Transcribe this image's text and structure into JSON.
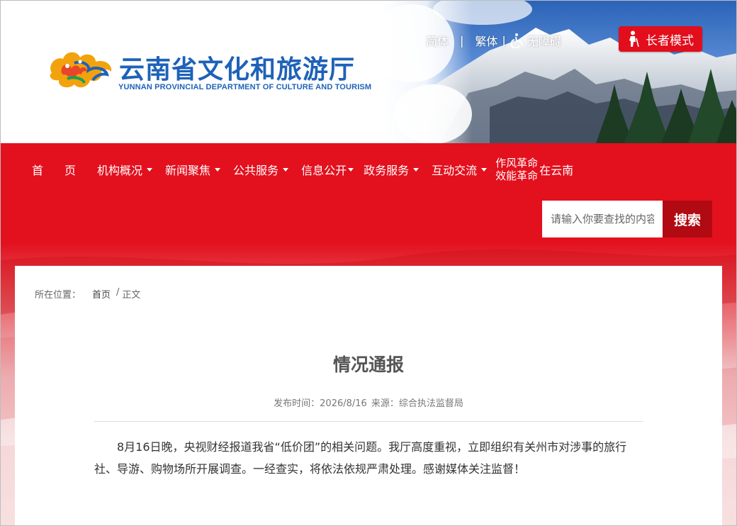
{
  "header": {
    "title": "云南省文化和旅游厅",
    "subtitle": "YUNNAN PROVINCIAL DEPARTMENT OF CULTURE AND TOURISM",
    "top_links": {
      "simplified": "简体",
      "separator": "|",
      "traditional": "繁体",
      "separator2": "|",
      "accessibility": "无障碍"
    },
    "elder_mode": "长者模式"
  },
  "nav": {
    "items": [
      {
        "label": "首页",
        "has_dropdown": false
      },
      {
        "label": "机构概况",
        "has_dropdown": true
      },
      {
        "label": "新闻聚焦",
        "has_dropdown": true
      },
      {
        "label": "公共服务",
        "has_dropdown": true
      },
      {
        "label": "信息公开",
        "has_dropdown": true
      },
      {
        "label": "政务服务",
        "has_dropdown": true
      },
      {
        "label": "互动交流",
        "has_dropdown": true
      }
    ],
    "special": {
      "line1": "作风革命",
      "line2": "效能革命",
      "suffix": "在云南"
    },
    "search": {
      "placeholder": "请输入你要查找的内容",
      "button": "搜索"
    }
  },
  "breadcrumb": {
    "label": "所在位置：",
    "home": "首页",
    "separator": "/",
    "current": "正文"
  },
  "article": {
    "title": "情况通报",
    "publish_label": "发布时间：",
    "publish_date": "2026/8/16",
    "source_label": "来源：",
    "source": "综合执法监督局",
    "body": "8月16日晚，央视财经报道我省“低价团”的相关问题。我厅高度重视，立即组织有关州市对涉事的旅行社、导游、购物场所开展调查。一经查实，将依法依规严肃处理。感谢媒体关注监督！"
  },
  "colors": {
    "brand_red": "#e3101e",
    "search_button": "#b10a12",
    "title_blue": "#1d62b8"
  }
}
